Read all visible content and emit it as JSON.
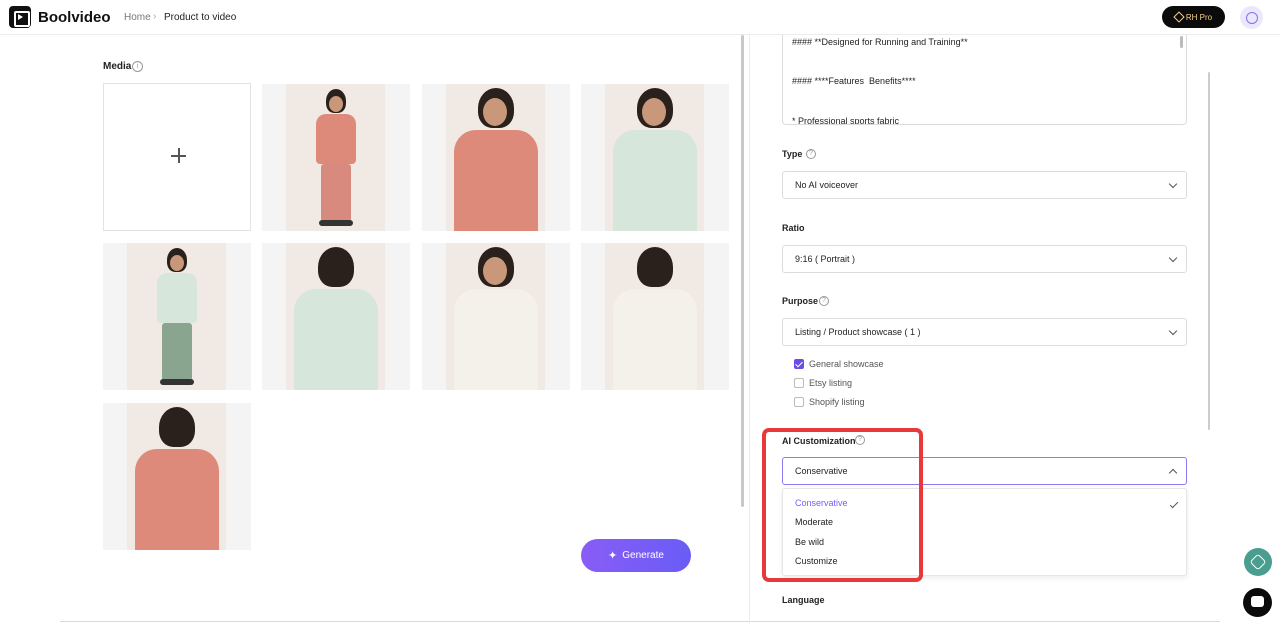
{
  "header": {
    "brand": "Boolvideo",
    "breadcrumb": [
      "Home",
      "Product to video"
    ],
    "pro_label": "RH Pro"
  },
  "media": {
    "label": "Media",
    "tiles": [
      {
        "shirt": "#de8a7a",
        "pants": "#d98a7e",
        "style": "full"
      },
      {
        "shirt": "#de8a7a",
        "pants": "#de8a7a",
        "style": "close"
      },
      {
        "shirt": "#d6e6da",
        "pants": "#8aa58f",
        "style": "close"
      },
      {
        "shirt": "#d6e6da",
        "pants": "#8aa58f",
        "style": "full"
      },
      {
        "shirt": "#d6e6da",
        "pants": "#8aa58f",
        "style": "back"
      },
      {
        "shirt": "#f4f1ea",
        "pants": "#1e2433",
        "style": "close"
      },
      {
        "shirt": "#f4f1ea",
        "pants": "#1e2433",
        "style": "back"
      },
      {
        "shirt": "#de8a7a",
        "pants": "#de8a7a",
        "style": "back"
      }
    ],
    "generate_label": "Generate"
  },
  "description": {
    "lines": [
      "#### **Designed for Running and Training**",
      "#### ****Features  Benefits****",
      "* Professional sports fabric"
    ]
  },
  "type": {
    "label": "Type",
    "value": "No AI voiceover"
  },
  "ratio": {
    "label": "Ratio",
    "value": "9:16 ( Portrait )"
  },
  "purpose": {
    "label": "Purpose",
    "value": "Listing / Product showcase ( 1 )",
    "options": [
      {
        "label": "General showcase",
        "checked": true
      },
      {
        "label": "Etsy listing",
        "checked": false
      },
      {
        "label": "Shopify listing",
        "checked": false
      }
    ]
  },
  "ai_customization": {
    "label": "AI Customization",
    "value": "Conservative",
    "options": [
      "Conservative",
      "Moderate",
      "Be wild",
      "Customize"
    ]
  },
  "language": {
    "label": "Language"
  },
  "colors": {
    "accent": "#7a5cf6",
    "highlight": "#e8393a"
  }
}
